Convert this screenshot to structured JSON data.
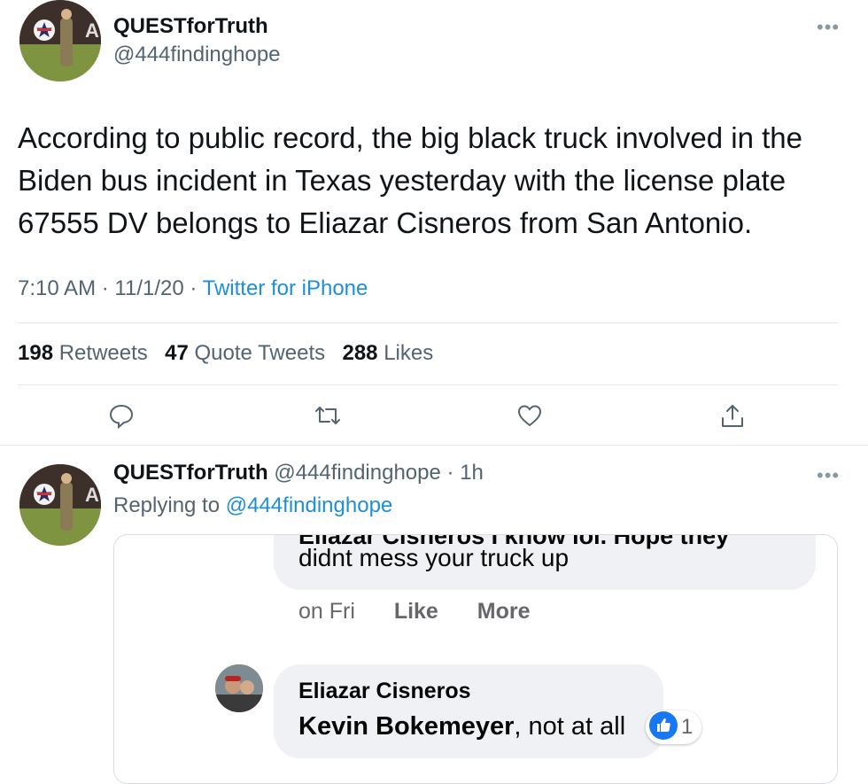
{
  "tweet": {
    "display_name": "QUESTforTruth",
    "handle": "@444findinghope",
    "text": "According to public record, the big black truck involved in the Biden bus incident in Texas yesterday with the license plate 67555 DV belongs to Eliazar Cisneros from San Antonio.",
    "time": "7:10 AM",
    "date": "11/1/20",
    "client": "Twitter for iPhone",
    "stats": {
      "retweets_count": "198",
      "retweets_label": "Retweets",
      "quotes_count": "47",
      "quotes_label": "Quote Tweets",
      "likes_count": "288",
      "likes_label": "Likes"
    },
    "more_icon": "more-horizontal-icon"
  },
  "actions": [
    "reply-icon",
    "retweet-icon",
    "like-icon",
    "share-icon"
  ],
  "reply": {
    "display_name": "QUESTforTruth",
    "handle": "@444findinghope",
    "age": "1h",
    "replying_to_label": "Replying to",
    "replying_to_handle": "@444findinghope",
    "embedded_screenshot": {
      "cut_off_text": "Eliazar Cisneros I know lol. Hope they",
      "comment_text": "didnt mess your truck up",
      "comment_time": "on Fri",
      "like_label": "Like",
      "more_label": "More",
      "reply_author": "Eliazar Cisneros",
      "reply_mention": "Kevin Bokemeyer",
      "reply_text": ", not at all",
      "reaction_count": "1",
      "reaction_icon": "thumbs-up-icon"
    }
  },
  "colors": {
    "link": "#1d8fd8",
    "muted": "#536471",
    "fb_like": "#1877f2"
  }
}
